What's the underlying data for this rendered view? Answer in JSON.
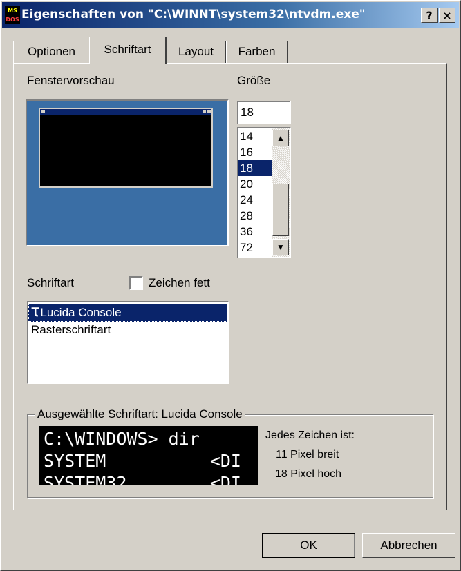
{
  "window": {
    "title": "Eigenschaften von \"C:\\WINNT\\system32\\ntvdm.exe\"",
    "app_icon_top": "MS",
    "app_icon_bottom": "DOS",
    "help_button": "?",
    "close_button": "×",
    "accent_color": "#0a246a"
  },
  "tabs": [
    {
      "label": "Optionen",
      "active": false
    },
    {
      "label": "Schriftart",
      "active": true
    },
    {
      "label": "Layout",
      "active": false
    },
    {
      "label": "Farben",
      "active": false
    }
  ],
  "preview": {
    "label": "Fenstervorschau"
  },
  "size": {
    "label": "Größe",
    "value": "18",
    "options": [
      "14",
      "16",
      "18",
      "20",
      "24",
      "28",
      "36",
      "72"
    ],
    "selected": "18"
  },
  "font": {
    "label": "Schriftart",
    "bold_checkbox_label": "Zeichen fett",
    "bold_checked": false,
    "items": [
      {
        "label": "Lucida Console",
        "icon": "truetype-icon",
        "selected": true
      },
      {
        "label": "Rasterschriftart",
        "selected": false
      }
    ]
  },
  "selected_font": {
    "group_label": "Ausgewählte Schriftart: Lucida Console",
    "sample_lines": [
      "C:\\WINDOWS> dir",
      "SYSTEM          <DI",
      "SYSTEM32        <DI"
    ],
    "info_heading": "Jedes Zeichen ist:",
    "width_text": "11 Pixel breit",
    "height_text": "18 Pixel hoch"
  },
  "buttons": {
    "ok": "OK",
    "cancel": "Abbrechen"
  }
}
